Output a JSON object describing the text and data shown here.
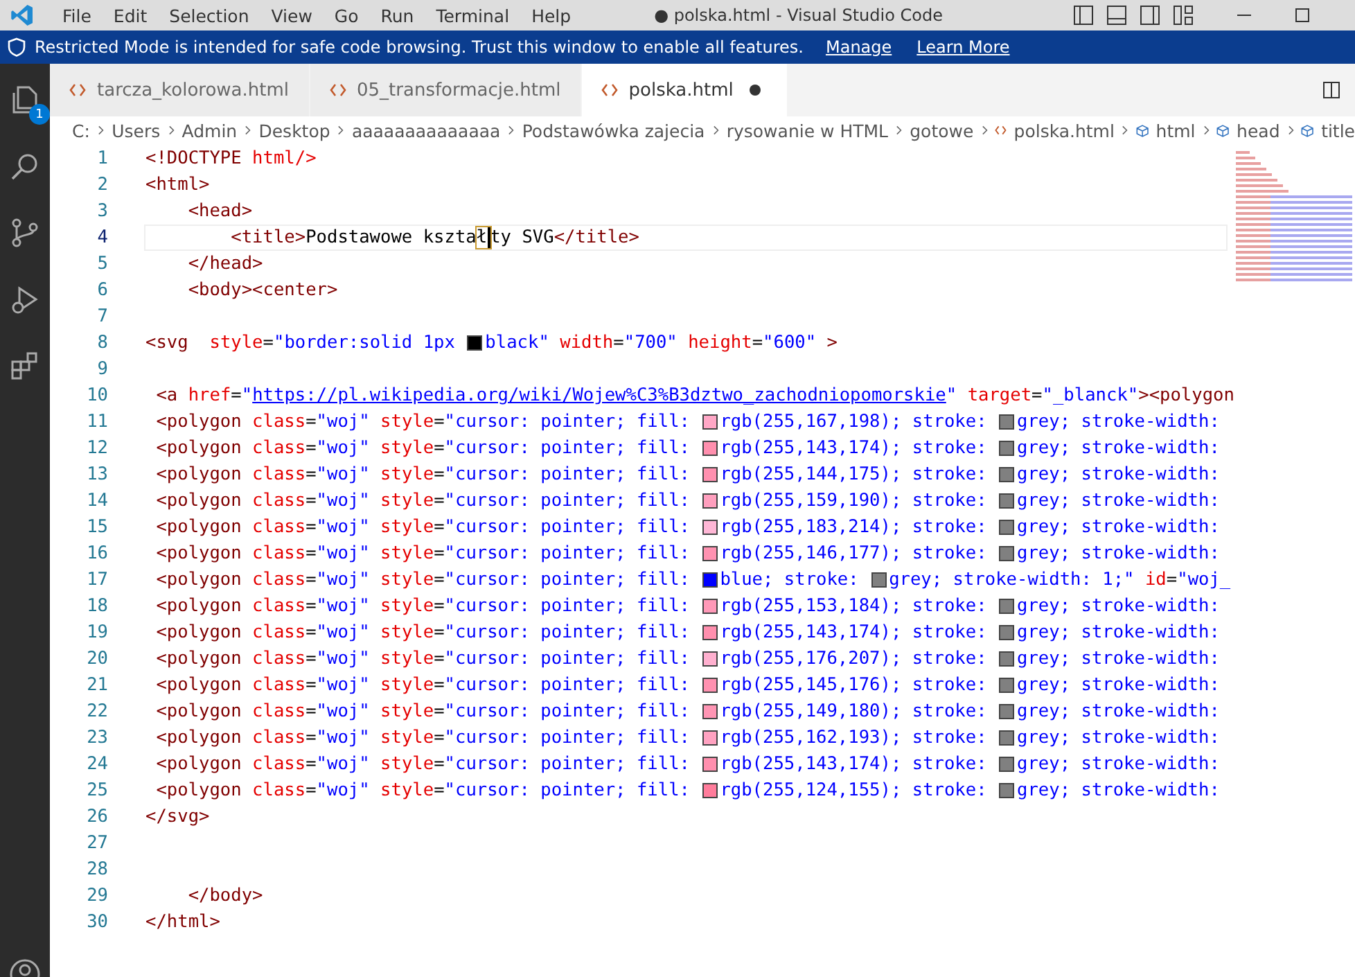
{
  "window": {
    "title": "● polska.html - Visual Studio Code",
    "menu": [
      "File",
      "Edit",
      "Selection",
      "View",
      "Go",
      "Run",
      "Terminal",
      "Help"
    ]
  },
  "banner": {
    "text": "Restricted Mode is intended for safe code browsing. Trust this window to enable all features.",
    "links": [
      "Manage",
      "Learn More"
    ]
  },
  "activity_bar": {
    "badge": "1"
  },
  "tabs": [
    {
      "label": "tarcza_kolorowa.html",
      "selected": false,
      "modified": false
    },
    {
      "label": "05_transformacje.html",
      "selected": false,
      "modified": false
    },
    {
      "label": "polska.html",
      "selected": true,
      "modified": true
    }
  ],
  "breadcrumbs": [
    {
      "kind": "folder",
      "label": "C:"
    },
    {
      "kind": "folder",
      "label": "Users"
    },
    {
      "kind": "folder",
      "label": "Admin"
    },
    {
      "kind": "folder",
      "label": "Desktop"
    },
    {
      "kind": "folder",
      "label": "aaaaaaaaaaaaaa"
    },
    {
      "kind": "folder",
      "label": "Podstawówka zajecia"
    },
    {
      "kind": "folder",
      "label": "rysowanie w HTML"
    },
    {
      "kind": "folder",
      "label": "gotowe"
    },
    {
      "kind": "file",
      "label": "polska.html"
    },
    {
      "kind": "symbol",
      "label": "html"
    },
    {
      "kind": "symbol",
      "label": "head"
    },
    {
      "kind": "symbol",
      "label": "title"
    }
  ],
  "editor": {
    "lines": [
      {
        "number": "1",
        "current": false,
        "tokens": [
          {
            "kind": "t",
            "text": "<!DOCTYPE "
          },
          {
            "kind": "a",
            "text": "html/>"
          }
        ]
      },
      {
        "number": "2",
        "current": false,
        "tokens": [
          {
            "kind": "t",
            "text": "<html>"
          }
        ]
      },
      {
        "number": "3",
        "current": false,
        "tokens": [
          {
            "kind": "t",
            "text": "    <head>"
          }
        ]
      },
      {
        "number": "4",
        "current": true,
        "tokens": [
          {
            "kind": "t",
            "text": "        <title>"
          },
          {
            "kind": "p",
            "text": "Podstawowe kszta"
          },
          {
            "kind": "h",
            "text": "ł"
          },
          {
            "kind": "p",
            "text": "ty SVG"
          },
          {
            "kind": "t",
            "text": "</title>"
          }
        ]
      },
      {
        "number": "5",
        "current": false,
        "tokens": [
          {
            "kind": "t",
            "text": "    </head>"
          }
        ]
      },
      {
        "number": "6",
        "current": false,
        "tokens": [
          {
            "kind": "t",
            "text": "    <body><center>"
          }
        ]
      },
      {
        "number": "7",
        "current": false
      },
      {
        "number": "8",
        "current": false,
        "tokens": [
          {
            "kind": "t",
            "text": "<svg"
          },
          {
            "kind": "a",
            "text": "  style"
          },
          {
            "kind": "p",
            "text": "="
          },
          {
            "kind": "v",
            "text": "\"border:solid 1px "
          },
          {
            "kind": "s",
            "color": "#000000"
          },
          {
            "kind": "v",
            "text": "black\""
          },
          {
            "kind": "a",
            "text": " width"
          },
          {
            "kind": "p",
            "text": "="
          },
          {
            "kind": "v",
            "text": "\"700\""
          },
          {
            "kind": "a",
            "text": " height"
          },
          {
            "kind": "p",
            "text": "="
          },
          {
            "kind": "v",
            "text": "\"600\""
          },
          {
            "kind": "t",
            "text": " >"
          }
        ]
      },
      {
        "number": "9",
        "current": false
      },
      {
        "number": "10",
        "current": false,
        "tokens": [
          {
            "kind": "t",
            "text": " <a"
          },
          {
            "kind": "a",
            "text": " href"
          },
          {
            "kind": "p",
            "text": "="
          },
          {
            "kind": "v",
            "text": "\""
          },
          {
            "kind": "l",
            "text": "https://pl.wikipedia.org/wiki/Wojew%C3%B3dztwo_zachodniopomorskie"
          },
          {
            "kind": "v",
            "text": "\""
          },
          {
            "kind": "a",
            "text": " target"
          },
          {
            "kind": "p",
            "text": "="
          },
          {
            "kind": "v",
            "text": "\"_blanck\""
          },
          {
            "kind": "t",
            "text": "><polygon"
          }
        ]
      },
      {
        "number": "11",
        "current": false,
        "tokens": [
          {
            "kind": "t",
            "text": " <polygon"
          },
          {
            "kind": "a",
            "text": " class"
          },
          {
            "kind": "p",
            "text": "="
          },
          {
            "kind": "v",
            "text": "\"woj\""
          },
          {
            "kind": "a",
            "text": " style"
          },
          {
            "kind": "p",
            "text": "="
          },
          {
            "kind": "v",
            "text": "\"cursor: pointer; fill: "
          },
          {
            "kind": "s",
            "color": "#ffa7c6"
          },
          {
            "kind": "v",
            "text": "rgb(255,167,198); stroke: "
          },
          {
            "kind": "s",
            "color": "#808080"
          },
          {
            "kind": "v",
            "text": "grey; stroke-width:"
          }
        ]
      },
      {
        "number": "12",
        "current": false,
        "tokens": [
          {
            "kind": "t",
            "text": " <polygon"
          },
          {
            "kind": "a",
            "text": " class"
          },
          {
            "kind": "p",
            "text": "="
          },
          {
            "kind": "v",
            "text": "\"woj\""
          },
          {
            "kind": "a",
            "text": " style"
          },
          {
            "kind": "p",
            "text": "="
          },
          {
            "kind": "v",
            "text": "\"cursor: pointer; fill: "
          },
          {
            "kind": "s",
            "color": "#ff8fae"
          },
          {
            "kind": "v",
            "text": "rgb(255,143,174); stroke: "
          },
          {
            "kind": "s",
            "color": "#808080"
          },
          {
            "kind": "v",
            "text": "grey; stroke-width:"
          }
        ]
      },
      {
        "number": "13",
        "current": false,
        "tokens": [
          {
            "kind": "t",
            "text": " <polygon"
          },
          {
            "kind": "a",
            "text": " class"
          },
          {
            "kind": "p",
            "text": "="
          },
          {
            "kind": "v",
            "text": "\"woj\""
          },
          {
            "kind": "a",
            "text": " style"
          },
          {
            "kind": "p",
            "text": "="
          },
          {
            "kind": "v",
            "text": "\"cursor: pointer; fill: "
          },
          {
            "kind": "s",
            "color": "#ff90af"
          },
          {
            "kind": "v",
            "text": "rgb(255,144,175); stroke: "
          },
          {
            "kind": "s",
            "color": "#808080"
          },
          {
            "kind": "v",
            "text": "grey; stroke-width:"
          }
        ]
      },
      {
        "number": "14",
        "current": false,
        "tokens": [
          {
            "kind": "t",
            "text": " <polygon"
          },
          {
            "kind": "a",
            "text": " class"
          },
          {
            "kind": "p",
            "text": "="
          },
          {
            "kind": "v",
            "text": "\"woj\""
          },
          {
            "kind": "a",
            "text": " style"
          },
          {
            "kind": "p",
            "text": "="
          },
          {
            "kind": "v",
            "text": "\"cursor: pointer; fill: "
          },
          {
            "kind": "s",
            "color": "#ff9fbe"
          },
          {
            "kind": "v",
            "text": "rgb(255,159,190); stroke: "
          },
          {
            "kind": "s",
            "color": "#808080"
          },
          {
            "kind": "v",
            "text": "grey; stroke-width:"
          }
        ]
      },
      {
        "number": "15",
        "current": false,
        "tokens": [
          {
            "kind": "t",
            "text": " <polygon"
          },
          {
            "kind": "a",
            "text": " class"
          },
          {
            "kind": "p",
            "text": "="
          },
          {
            "kind": "v",
            "text": "\"woj\""
          },
          {
            "kind": "a",
            "text": " style"
          },
          {
            "kind": "p",
            "text": "="
          },
          {
            "kind": "v",
            "text": "\"cursor: pointer; fill: "
          },
          {
            "kind": "s",
            "color": "#ffb7d6"
          },
          {
            "kind": "v",
            "text": "rgb(255,183,214); stroke: "
          },
          {
            "kind": "s",
            "color": "#808080"
          },
          {
            "kind": "v",
            "text": "grey; stroke-width:"
          }
        ]
      },
      {
        "number": "16",
        "current": false,
        "tokens": [
          {
            "kind": "t",
            "text": " <polygon"
          },
          {
            "kind": "a",
            "text": " class"
          },
          {
            "kind": "p",
            "text": "="
          },
          {
            "kind": "v",
            "text": "\"woj\""
          },
          {
            "kind": "a",
            "text": " style"
          },
          {
            "kind": "p",
            "text": "="
          },
          {
            "kind": "v",
            "text": "\"cursor: pointer; fill: "
          },
          {
            "kind": "s",
            "color": "#ff92b1"
          },
          {
            "kind": "v",
            "text": "rgb(255,146,177); stroke: "
          },
          {
            "kind": "s",
            "color": "#808080"
          },
          {
            "kind": "v",
            "text": "grey; stroke-width:"
          }
        ]
      },
      {
        "number": "17",
        "current": false,
        "tokens": [
          {
            "kind": "t",
            "text": " <polygon"
          },
          {
            "kind": "a",
            "text": " class"
          },
          {
            "kind": "p",
            "text": "="
          },
          {
            "kind": "v",
            "text": "\"woj\""
          },
          {
            "kind": "a",
            "text": " style"
          },
          {
            "kind": "p",
            "text": "="
          },
          {
            "kind": "v",
            "text": "\"cursor: pointer; fill: "
          },
          {
            "kind": "s",
            "color": "#0000ff"
          },
          {
            "kind": "v",
            "text": "blue; stroke: "
          },
          {
            "kind": "s",
            "color": "#808080"
          },
          {
            "kind": "v",
            "text": "grey; stroke-width: 1;\""
          },
          {
            "kind": "a",
            "text": " id"
          },
          {
            "kind": "p",
            "text": "="
          },
          {
            "kind": "v",
            "text": "\"woj_"
          }
        ]
      },
      {
        "number": "18",
        "current": false,
        "tokens": [
          {
            "kind": "t",
            "text": " <polygon"
          },
          {
            "kind": "a",
            "text": " class"
          },
          {
            "kind": "p",
            "text": "="
          },
          {
            "kind": "v",
            "text": "\"woj\""
          },
          {
            "kind": "a",
            "text": " style"
          },
          {
            "kind": "p",
            "text": "="
          },
          {
            "kind": "v",
            "text": "\"cursor: pointer; fill: "
          },
          {
            "kind": "s",
            "color": "#ff99b8"
          },
          {
            "kind": "v",
            "text": "rgb(255,153,184); stroke: "
          },
          {
            "kind": "s",
            "color": "#808080"
          },
          {
            "kind": "v",
            "text": "grey; stroke-width:"
          }
        ]
      },
      {
        "number": "19",
        "current": false,
        "tokens": [
          {
            "kind": "t",
            "text": " <polygon"
          },
          {
            "kind": "a",
            "text": " class"
          },
          {
            "kind": "p",
            "text": "="
          },
          {
            "kind": "v",
            "text": "\"woj\""
          },
          {
            "kind": "a",
            "text": " style"
          },
          {
            "kind": "p",
            "text": "="
          },
          {
            "kind": "v",
            "text": "\"cursor: pointer; fill: "
          },
          {
            "kind": "s",
            "color": "#ff8fae"
          },
          {
            "kind": "v",
            "text": "rgb(255,143,174); stroke: "
          },
          {
            "kind": "s",
            "color": "#808080"
          },
          {
            "kind": "v",
            "text": "grey; stroke-width:"
          }
        ]
      },
      {
        "number": "20",
        "current": false,
        "tokens": [
          {
            "kind": "t",
            "text": " <polygon"
          },
          {
            "kind": "a",
            "text": " class"
          },
          {
            "kind": "p",
            "text": "="
          },
          {
            "kind": "v",
            "text": "\"woj\""
          },
          {
            "kind": "a",
            "text": " style"
          },
          {
            "kind": "p",
            "text": "="
          },
          {
            "kind": "v",
            "text": "\"cursor: pointer; fill: "
          },
          {
            "kind": "s",
            "color": "#ffb0cf"
          },
          {
            "kind": "v",
            "text": "rgb(255,176,207); stroke: "
          },
          {
            "kind": "s",
            "color": "#808080"
          },
          {
            "kind": "v",
            "text": "grey; stroke-width:"
          }
        ]
      },
      {
        "number": "21",
        "current": false,
        "tokens": [
          {
            "kind": "t",
            "text": " <polygon"
          },
          {
            "kind": "a",
            "text": " class"
          },
          {
            "kind": "p",
            "text": "="
          },
          {
            "kind": "v",
            "text": "\"woj\""
          },
          {
            "kind": "a",
            "text": " style"
          },
          {
            "kind": "p",
            "text": "="
          },
          {
            "kind": "v",
            "text": "\"cursor: pointer; fill: "
          },
          {
            "kind": "s",
            "color": "#ff91b0"
          },
          {
            "kind": "v",
            "text": "rgb(255,145,176); stroke: "
          },
          {
            "kind": "s",
            "color": "#808080"
          },
          {
            "kind": "v",
            "text": "grey; stroke-width:"
          }
        ]
      },
      {
        "number": "22",
        "current": false,
        "tokens": [
          {
            "kind": "t",
            "text": " <polygon"
          },
          {
            "kind": "a",
            "text": " class"
          },
          {
            "kind": "p",
            "text": "="
          },
          {
            "kind": "v",
            "text": "\"woj\""
          },
          {
            "kind": "a",
            "text": " style"
          },
          {
            "kind": "p",
            "text": "="
          },
          {
            "kind": "v",
            "text": "\"cursor: pointer; fill: "
          },
          {
            "kind": "s",
            "color": "#ff95b4"
          },
          {
            "kind": "v",
            "text": "rgb(255,149,180); stroke: "
          },
          {
            "kind": "s",
            "color": "#808080"
          },
          {
            "kind": "v",
            "text": "grey; stroke-width:"
          }
        ]
      },
      {
        "number": "23",
        "current": false,
        "tokens": [
          {
            "kind": "t",
            "text": " <polygon"
          },
          {
            "kind": "a",
            "text": " class"
          },
          {
            "kind": "p",
            "text": "="
          },
          {
            "kind": "v",
            "text": "\"woj\""
          },
          {
            "kind": "a",
            "text": " style"
          },
          {
            "kind": "p",
            "text": "="
          },
          {
            "kind": "v",
            "text": "\"cursor: pointer; fill: "
          },
          {
            "kind": "s",
            "color": "#ffa2c1"
          },
          {
            "kind": "v",
            "text": "rgb(255,162,193); stroke: "
          },
          {
            "kind": "s",
            "color": "#808080"
          },
          {
            "kind": "v",
            "text": "grey; stroke-width:"
          }
        ]
      },
      {
        "number": "24",
        "current": false,
        "tokens": [
          {
            "kind": "t",
            "text": " <polygon"
          },
          {
            "kind": "a",
            "text": " class"
          },
          {
            "kind": "p",
            "text": "="
          },
          {
            "kind": "v",
            "text": "\"woj\""
          },
          {
            "kind": "a",
            "text": " style"
          },
          {
            "kind": "p",
            "text": "="
          },
          {
            "kind": "v",
            "text": "\"cursor: pointer; fill: "
          },
          {
            "kind": "s",
            "color": "#ff8fae"
          },
          {
            "kind": "v",
            "text": "rgb(255,143,174); stroke: "
          },
          {
            "kind": "s",
            "color": "#808080"
          },
          {
            "kind": "v",
            "text": "grey; stroke-width:"
          }
        ]
      },
      {
        "number": "25",
        "current": false,
        "tokens": [
          {
            "kind": "t",
            "text": " <polygon"
          },
          {
            "kind": "a",
            "text": " class"
          },
          {
            "kind": "p",
            "text": "="
          },
          {
            "kind": "v",
            "text": "\"woj\""
          },
          {
            "kind": "a",
            "text": " style"
          },
          {
            "kind": "p",
            "text": "="
          },
          {
            "kind": "v",
            "text": "\"cursor: pointer; fill: "
          },
          {
            "kind": "s",
            "color": "#ff7c9b"
          },
          {
            "kind": "v",
            "text": "rgb(255,124,155); stroke: "
          },
          {
            "kind": "s",
            "color": "#808080"
          },
          {
            "kind": "v",
            "text": "grey; stroke-width:"
          }
        ]
      },
      {
        "number": "26",
        "current": false,
        "tokens": [
          {
            "kind": "t",
            "text": "</svg>"
          }
        ]
      },
      {
        "number": "27",
        "current": false
      },
      {
        "number": "28",
        "current": false
      },
      {
        "number": "29",
        "current": false,
        "tokens": [
          {
            "kind": "t",
            "text": "    </body>"
          }
        ]
      },
      {
        "number": "30",
        "current": false,
        "tokens": [
          {
            "kind": "t",
            "text": "</html>"
          }
        ]
      }
    ]
  }
}
